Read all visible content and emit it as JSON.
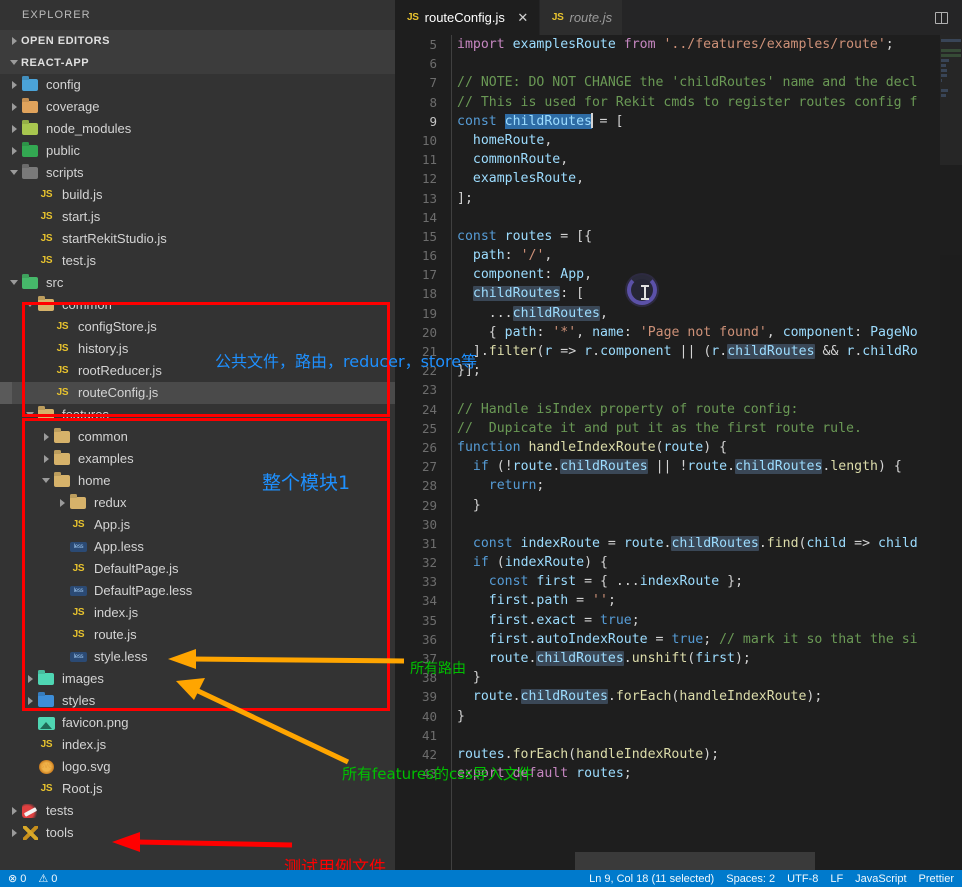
{
  "sidebar": {
    "title": "EXPLORER",
    "sections": [
      {
        "label": "OPEN EDITORS",
        "state": "collapsed"
      },
      {
        "label": "REACT-APP",
        "state": "expanded"
      }
    ],
    "tree": [
      {
        "label": "config",
        "kind": "folder",
        "color": "#4ba3d8",
        "depth": 1,
        "twisty": "closed"
      },
      {
        "label": "coverage",
        "kind": "folder",
        "color": "#e0a35c",
        "depth": 1,
        "twisty": "closed"
      },
      {
        "label": "node_modules",
        "kind": "folder",
        "color": "#a8c64f",
        "depth": 1,
        "twisty": "closed"
      },
      {
        "label": "public",
        "kind": "folder",
        "color": "#33a852",
        "depth": 1,
        "twisty": "closed"
      },
      {
        "label": "scripts",
        "kind": "folder",
        "color": "#7a7a7a",
        "depth": 1,
        "twisty": "open"
      },
      {
        "label": "build.js",
        "kind": "js",
        "depth": 2,
        "twisty": "none"
      },
      {
        "label": "start.js",
        "kind": "js",
        "depth": 2,
        "twisty": "none"
      },
      {
        "label": "startRekitStudio.js",
        "kind": "js",
        "depth": 2,
        "twisty": "none"
      },
      {
        "label": "test.js",
        "kind": "js",
        "depth": 2,
        "twisty": "none"
      },
      {
        "label": "src",
        "kind": "folder",
        "color": "#46b86a",
        "depth": 1,
        "twisty": "open"
      },
      {
        "label": "common",
        "kind": "folder",
        "color": "#d6b26a",
        "depth": 2,
        "twisty": "open"
      },
      {
        "label": "configStore.js",
        "kind": "js",
        "depth": 3,
        "twisty": "none"
      },
      {
        "label": "history.js",
        "kind": "js",
        "depth": 3,
        "twisty": "none"
      },
      {
        "label": "rootReducer.js",
        "kind": "js",
        "depth": 3,
        "twisty": "none"
      },
      {
        "label": "routeConfig.js",
        "kind": "js",
        "depth": 3,
        "twisty": "none",
        "selected": true
      },
      {
        "label": "features",
        "kind": "folder",
        "color": "#d6b26a",
        "depth": 2,
        "twisty": "open"
      },
      {
        "label": "common",
        "kind": "folder",
        "color": "#d6b26a",
        "depth": 3,
        "twisty": "closed"
      },
      {
        "label": "examples",
        "kind": "folder",
        "color": "#d6b26a",
        "depth": 3,
        "twisty": "closed"
      },
      {
        "label": "home",
        "kind": "folder",
        "color": "#d6b26a",
        "depth": 3,
        "twisty": "open"
      },
      {
        "label": "redux",
        "kind": "folder",
        "color": "#d6b26a",
        "depth": 4,
        "twisty": "closed"
      },
      {
        "label": "App.js",
        "kind": "js",
        "depth": 4,
        "twisty": "none"
      },
      {
        "label": "App.less",
        "kind": "less",
        "depth": 4,
        "twisty": "none"
      },
      {
        "label": "DefaultPage.js",
        "kind": "js",
        "depth": 4,
        "twisty": "none"
      },
      {
        "label": "DefaultPage.less",
        "kind": "less",
        "depth": 4,
        "twisty": "none"
      },
      {
        "label": "index.js",
        "kind": "js",
        "depth": 4,
        "twisty": "none"
      },
      {
        "label": "route.js",
        "kind": "js",
        "depth": 4,
        "twisty": "none"
      },
      {
        "label": "style.less",
        "kind": "less",
        "depth": 4,
        "twisty": "none"
      },
      {
        "label": "images",
        "kind": "folder",
        "color": "#4fd6b3",
        "depth": 2,
        "twisty": "closed"
      },
      {
        "label": "styles",
        "kind": "folder",
        "color": "#3d8ed8",
        "depth": 2,
        "twisty": "closed"
      },
      {
        "label": "favicon.png",
        "kind": "png",
        "depth": 2,
        "twisty": "none"
      },
      {
        "label": "index.js",
        "kind": "js",
        "depth": 2,
        "twisty": "none"
      },
      {
        "label": "logo.svg",
        "kind": "svg",
        "depth": 2,
        "twisty": "none"
      },
      {
        "label": "Root.js",
        "kind": "js",
        "depth": 2,
        "twisty": "none"
      },
      {
        "label": "tests",
        "kind": "pen",
        "depth": 1,
        "twisty": "closed"
      },
      {
        "label": "tools",
        "kind": "tools",
        "depth": 1,
        "twisty": "closed"
      }
    ]
  },
  "editor": {
    "tabs": [
      {
        "label": "routeConfig.js",
        "icon": "js-icon",
        "active": true,
        "preview": false,
        "close": "✕"
      },
      {
        "label": "route.js",
        "icon": "js-icon",
        "active": false,
        "preview": true,
        "close": ""
      }
    ],
    "split_icon": "split-editor-icon",
    "first_visible_line": 5,
    "cursor_line": 9,
    "code_lines": [
      {
        "n": 5,
        "text": "import examplesRoute from '../features/examples/route';"
      },
      {
        "n": 6,
        "text": ""
      },
      {
        "n": 7,
        "text": "// NOTE: DO NOT CHANGE the 'childRoutes' name and the decl"
      },
      {
        "n": 8,
        "text": "// This is used for Rekit cmds to register routes config f"
      },
      {
        "n": 9,
        "text": "const childRoutes = ["
      },
      {
        "n": 10,
        "text": "  homeRoute,"
      },
      {
        "n": 11,
        "text": "  commonRoute,"
      },
      {
        "n": 12,
        "text": "  examplesRoute,"
      },
      {
        "n": 13,
        "text": "];"
      },
      {
        "n": 14,
        "text": ""
      },
      {
        "n": 15,
        "text": "const routes = [{"
      },
      {
        "n": 16,
        "text": "  path: '/',"
      },
      {
        "n": 17,
        "text": "  component: App,"
      },
      {
        "n": 18,
        "text": "  childRoutes: ["
      },
      {
        "n": 19,
        "text": "    ...childRoutes,"
      },
      {
        "n": 20,
        "text": "    { path: '*', name: 'Page not found', component: PageNo"
      },
      {
        "n": 21,
        "text": "  ].filter(r => r.component || (r.childRoutes && r.childRo"
      },
      {
        "n": 22,
        "text": "}];"
      },
      {
        "n": 23,
        "text": ""
      },
      {
        "n": 24,
        "text": "// Handle isIndex property of route config:"
      },
      {
        "n": 25,
        "text": "//  Dupicate it and put it as the first route rule."
      },
      {
        "n": 26,
        "text": "function handleIndexRoute(route) {"
      },
      {
        "n": 27,
        "text": "  if (!route.childRoutes || !route.childRoutes.length) {"
      },
      {
        "n": 28,
        "text": "    return;"
      },
      {
        "n": 29,
        "text": "  }"
      },
      {
        "n": 30,
        "text": ""
      },
      {
        "n": 31,
        "text": "  const indexRoute = route.childRoutes.find(child => child"
      },
      {
        "n": 32,
        "text": "  if (indexRoute) {"
      },
      {
        "n": 33,
        "text": "    const first = { ...indexRoute };"
      },
      {
        "n": 34,
        "text": "    first.path = '';"
      },
      {
        "n": 35,
        "text": "    first.exact = true;"
      },
      {
        "n": 36,
        "text": "    first.autoIndexRoute = true; // mark it so that the si"
      },
      {
        "n": 37,
        "text": "    route.childRoutes.unshift(first);"
      },
      {
        "n": 38,
        "text": "  }"
      },
      {
        "n": 39,
        "text": "  route.childRoutes.forEach(handleIndexRoute);"
      },
      {
        "n": 40,
        "text": "}"
      },
      {
        "n": 41,
        "text": ""
      },
      {
        "n": 42,
        "text": "routes.forEach(handleIndexRoute);"
      },
      {
        "n": 43,
        "text": "export default routes;"
      }
    ]
  },
  "annotations": {
    "boxes": [
      {
        "name": "common-folder-highlight-box",
        "color": "#ff0000"
      },
      {
        "name": "features-folder-highlight-box",
        "color": "#ff0000"
      }
    ],
    "texts": [
      {
        "id": "common-note",
        "text": "公共文件，路由，reducer，store等",
        "color": "#1e90ff"
      },
      {
        "id": "module-note",
        "text": "整个模块1",
        "color": "#1e90ff"
      },
      {
        "id": "routes-note",
        "text": "所有路由",
        "color": "#00c000"
      },
      {
        "id": "css-note",
        "text": "所有features的css导入文件",
        "color": "#00c000"
      },
      {
        "id": "tests-note",
        "text": "测试用例文件",
        "color": "#ff0000"
      }
    ],
    "arrows": [
      {
        "id": "route-js-arrow",
        "color": "#ffa500",
        "from": "所有路由",
        "to": "route.js"
      },
      {
        "id": "style-less-arrow",
        "color": "#ffa500",
        "from": "所有features的css导入文件",
        "to": "style.less"
      },
      {
        "id": "tests-arrow",
        "color": "#ff0000",
        "from": "测试用例文件",
        "to": "tests"
      }
    ]
  },
  "statusbar": {
    "left": [
      "⊗ 0",
      "⚠ 0"
    ],
    "right": [
      "Ln 9, Col 18 (11 selected)",
      "Spaces: 2",
      "UTF-8",
      "LF",
      "JavaScript",
      "Prettier"
    ]
  },
  "colors": {
    "accent": "#007acc",
    "sidebar_bg": "#333333",
    "editor_bg": "#1e1e1e",
    "tabbar_bg": "#252526",
    "annotation_red": "#ff0000",
    "annotation_blue": "#1e90ff",
    "annotation_green": "#00c000",
    "annotation_orange": "#ffa500"
  }
}
